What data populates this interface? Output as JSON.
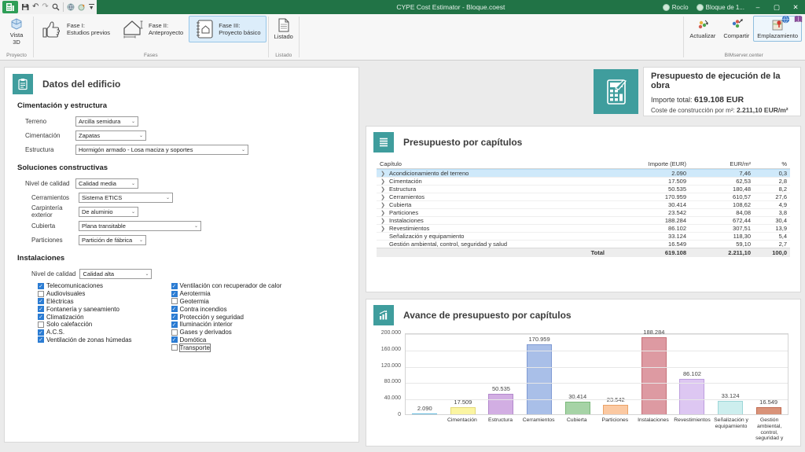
{
  "colors": {
    "titlebar_green": "#217346",
    "accent_teal": "#3f9d9d",
    "selected_row_blue": "#cfe9fa",
    "checkbox_blue": "#2b7cd3",
    "active_button_blue": "#dcedfa"
  },
  "titlebar": {
    "title": "CYPE Cost Estimator - Bloque.coest",
    "user": "Rocío",
    "project": "Bloque de 1...",
    "window": {
      "minimize": "–",
      "maximize": "▢",
      "close": "✕"
    }
  },
  "ribbon": {
    "groups": {
      "proyecto": {
        "label": "Proyecto",
        "button_label": "Vista 3D"
      },
      "fases": {
        "label": "Fases",
        "buttons": [
          {
            "line1": "Fase I:",
            "line2": "Estudios previos",
            "active": false
          },
          {
            "line1": "Fase II:",
            "line2": "Anteproyecto",
            "active": false
          },
          {
            "line1": "Fase III:",
            "line2": "Proyecto básico",
            "active": true
          }
        ]
      },
      "listado": {
        "label": "Listado",
        "button_label": "Listado"
      },
      "bimserver": {
        "label": "BIMserver.center",
        "buttons": [
          {
            "label": "Actualizar",
            "active": false
          },
          {
            "label": "Compartir",
            "active": false
          },
          {
            "label": "Emplazamiento",
            "active": true
          }
        ]
      }
    }
  },
  "building_panel": {
    "title": "Datos del edificio",
    "section1": {
      "title": "Cimentación y estructura",
      "fields": [
        {
          "label": "Terreno",
          "value": "Arcilla semidura"
        },
        {
          "label": "Cimentación",
          "value": "Zapatas"
        },
        {
          "label": "Estructura",
          "value": "Hormigón armado - Losa maciza y soportes"
        }
      ]
    },
    "section2": {
      "title": "Soluciones constructivas",
      "fields": [
        {
          "label": "Nivel de calidad",
          "value": "Calidad media"
        },
        {
          "label": "Cerramientos",
          "value": "Sistema ETICS"
        },
        {
          "label": "Carpintería exterior",
          "value": "De aluminio"
        },
        {
          "label": "Cubierta",
          "value": "Plana transitable"
        },
        {
          "label": "Particiones",
          "value": "Partición de fábrica"
        }
      ]
    },
    "section3": {
      "title": "Instalaciones",
      "quality": {
        "label": "Nivel de calidad",
        "value": "Calidad alta"
      },
      "col1": [
        {
          "label": "Telecomunicaciones",
          "checked": true
        },
        {
          "label": "Audiovisuales",
          "checked": false
        },
        {
          "label": "Eléctricas",
          "checked": true
        },
        {
          "label": "Fontanería y saneamiento",
          "checked": true
        },
        {
          "label": "Climatización",
          "checked": true
        },
        {
          "label": "Solo calefacción",
          "checked": false
        },
        {
          "label": "A.C.S.",
          "checked": true
        },
        {
          "label": "Ventilación de zonas húmedas",
          "checked": true
        }
      ],
      "col2": [
        {
          "label": "Ventilación con recuperador de calor",
          "checked": true
        },
        {
          "label": "Aerotermia",
          "checked": true
        },
        {
          "label": "Geotermia",
          "checked": false
        },
        {
          "label": "Contra incendios",
          "checked": true
        },
        {
          "label": "Protección y seguridad",
          "checked": true
        },
        {
          "label": "Iluminación interior",
          "checked": true
        },
        {
          "label": "Gases y derivados",
          "checked": false
        },
        {
          "label": "Domótica",
          "checked": true
        },
        {
          "label": "Transporte",
          "checked": false,
          "focused": true
        }
      ]
    }
  },
  "summary": {
    "title": "Presupuesto de ejecución de la obra",
    "total_label": "Importe total:",
    "total_value": "619.108 EUR",
    "cost_label": "Coste de construcción por m²:",
    "cost_value": "2.211,10 EUR/m²"
  },
  "chapters_table": {
    "title": "Presupuesto por capítulos",
    "columns": [
      "Capítulo",
      "Importe (EUR)",
      "EUR/m²",
      "%"
    ],
    "rows": [
      {
        "name": "Acondicionamiento del terreno",
        "importe": "2.090",
        "eur_m2": "7,46",
        "pct": "0,3",
        "expandable": true,
        "selected": true
      },
      {
        "name": "Cimentación",
        "importe": "17.509",
        "eur_m2": "62,53",
        "pct": "2,8",
        "expandable": true,
        "selected": false
      },
      {
        "name": "Estructura",
        "importe": "50.535",
        "eur_m2": "180,48",
        "pct": "8,2",
        "expandable": true,
        "selected": false
      },
      {
        "name": "Cerramientos",
        "importe": "170.959",
        "eur_m2": "610,57",
        "pct": "27,6",
        "expandable": true,
        "selected": false
      },
      {
        "name": "Cubierta",
        "importe": "30.414",
        "eur_m2": "108,62",
        "pct": "4,9",
        "expandable": true,
        "selected": false
      },
      {
        "name": "Particiones",
        "importe": "23.542",
        "eur_m2": "84,08",
        "pct": "3,8",
        "expandable": true,
        "selected": false
      },
      {
        "name": "Instalaciones",
        "importe": "188.284",
        "eur_m2": "672,44",
        "pct": "30,4",
        "expandable": true,
        "selected": false
      },
      {
        "name": "Revestimientos",
        "importe": "86.102",
        "eur_m2": "307,51",
        "pct": "13,9",
        "expandable": true,
        "selected": false
      },
      {
        "name": "Señalización y equipamiento",
        "importe": "33.124",
        "eur_m2": "118,30",
        "pct": "5,4",
        "expandable": false,
        "selected": false
      },
      {
        "name": "Gestión ambiental, control, seguridad y salud",
        "importe": "16.549",
        "eur_m2": "59,10",
        "pct": "2,7",
        "expandable": false,
        "selected": false
      }
    ],
    "total": {
      "label": "Total",
      "importe": "619.108",
      "eur_m2": "2.211,10",
      "pct": "100,0"
    }
  },
  "chart_data": {
    "type": "bar",
    "title": "Avance de presupuesto por capítulos",
    "categories": [
      "",
      "Cimentación",
      "Estructura",
      "Cerramientos",
      "Cubierta",
      "Particiones",
      "Instalaciones",
      "Revestimientos",
      "Señalización y equipamiento",
      "Gestión ambiental, control, seguridad y"
    ],
    "values": [
      2090,
      17509,
      50535,
      170959,
      30414,
      23542,
      188284,
      86102,
      33124,
      16549
    ],
    "value_labels": [
      "2.090",
      "17.509",
      "50.535",
      "170.959",
      "30.414",
      "23.542",
      "188.284",
      "86.102",
      "33.124",
      "16.549"
    ],
    "bar_colors": [
      "#92d4ef",
      "#fbf5a2",
      "#d2aee3",
      "#a9bfe8",
      "#a6d3a6",
      "#fbc9a2",
      "#dd9aa2",
      "#ddc7f2",
      "#cdeeee",
      "#d99379"
    ],
    "bar_borders": [
      "#5fb8dd",
      "#e3d978",
      "#b288cc",
      "#7f9ad4",
      "#7ab87a",
      "#eba368",
      "#c77078",
      "#bd9ede",
      "#9dd6d8",
      "#c06a50"
    ],
    "ylim": [
      0,
      200000
    ],
    "yticks": [
      "200.000",
      "160.000",
      "120.000",
      "80.000",
      "40.000",
      "0"
    ],
    "grid": true,
    "legend": false
  }
}
